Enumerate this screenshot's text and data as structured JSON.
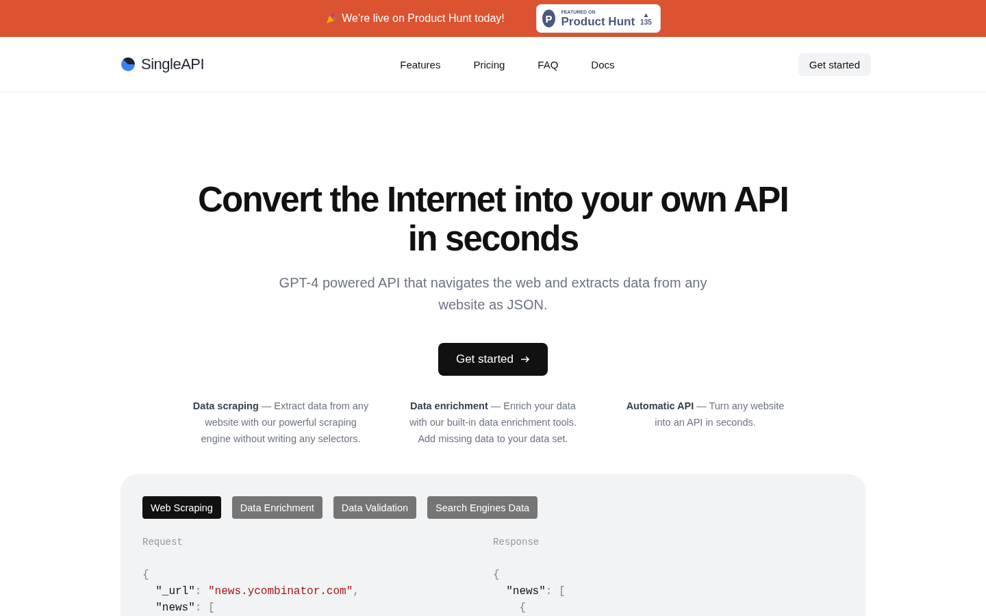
{
  "banner": {
    "message": "We're live on Product Hunt today!",
    "badge": {
      "eyebrow": "FEATURED ON",
      "name": "Product Hunt",
      "logo_letter": "P",
      "votes": "135",
      "arrow": "▲"
    }
  },
  "nav": {
    "brand": "SingleAPI",
    "links": [
      "Features",
      "Pricing",
      "FAQ",
      "Docs"
    ],
    "cta": "Get started"
  },
  "hero": {
    "title": "Convert the Internet into your own API in seconds",
    "subtitle": "GPT-4 powered API that navigates the web and extracts data from any website as JSON.",
    "cta": "Get started"
  },
  "features": [
    {
      "text": "**Data scraping** — Extract data from any website with our powerful scraping engine without writing any selectors."
    },
    {
      "text": "**Data enrichment** — Enrich your data with our built-in data enrichment tools. Add missing data to your data set."
    },
    {
      "text": "**Automatic API** — Turn any website into an API in seconds."
    }
  ],
  "demo": {
    "tabs": [
      {
        "label": "Web Scraping",
        "selected": true
      },
      {
        "label": "Data Enrichment",
        "selected": false
      },
      {
        "label": "Data Validation",
        "selected": false
      },
      {
        "label": "Search Engines Data",
        "selected": false
      }
    ],
    "panes": [
      {
        "label": "Request",
        "lines": [
          [
            {
              "kind": "punct",
              "text": "{"
            }
          ],
          [
            {
              "kind": "key",
              "text": "  \"_url\""
            },
            {
              "kind": "punct",
              "text": ": "
            },
            {
              "kind": "string",
              "text": "\"news.ycombinator.com\""
            },
            {
              "kind": "punct",
              "text": ","
            }
          ],
          [
            {
              "kind": "key",
              "text": "  \"news\""
            },
            {
              "kind": "punct",
              "text": ": ["
            }
          ]
        ]
      },
      {
        "label": "Response",
        "lines": [
          [
            {
              "kind": "punct",
              "text": "{"
            }
          ],
          [
            {
              "kind": "key",
              "text": "  \"news\""
            },
            {
              "kind": "punct",
              "text": ": ["
            }
          ],
          [
            {
              "kind": "punct",
              "text": "    {"
            }
          ]
        ]
      }
    ]
  }
}
